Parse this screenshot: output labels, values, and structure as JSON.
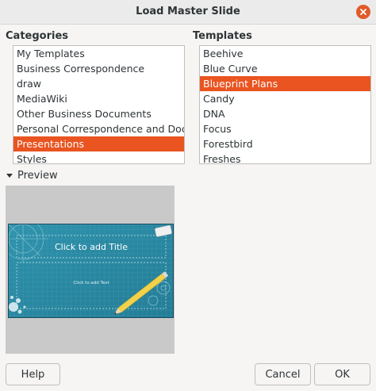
{
  "window": {
    "title": "Load Master Slide"
  },
  "categories": {
    "label": "Categories",
    "items": [
      "My Templates",
      "Business Correspondence",
      "draw",
      "MediaWiki",
      "Other Business Documents",
      "Personal Correspondence and Documents",
      "Presentations",
      "Styles"
    ],
    "selected": "Presentations"
  },
  "templates": {
    "label": "Templates",
    "items": [
      "Beehive",
      "Blue Curve",
      "Blueprint Plans",
      "Candy",
      "DNA",
      "Focus",
      "Forestbird",
      "Freshes"
    ],
    "selected": "Blueprint Plans"
  },
  "preview": {
    "label": "Preview",
    "expanded": true,
    "slide_title": "Click to add Title",
    "slide_text": "Click to add Text"
  },
  "buttons": {
    "help": "Help",
    "cancel": "Cancel",
    "ok": "OK"
  },
  "colors": {
    "accent": "#e95420",
    "slide_background": "#2b8aa3",
    "pencil": "#f2d24b"
  }
}
